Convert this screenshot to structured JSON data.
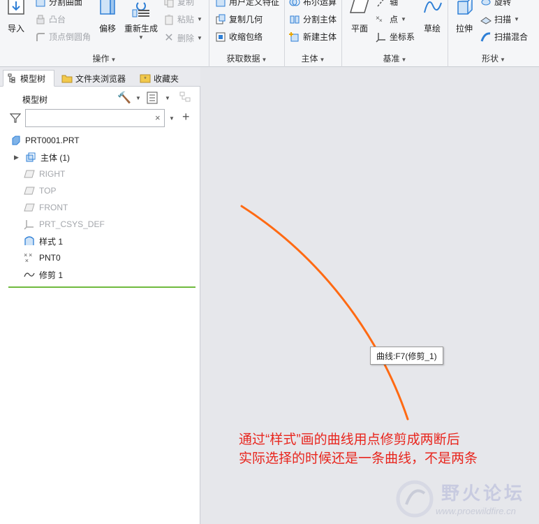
{
  "ribbon": {
    "import_label": "导入",
    "split_surface_label": "分割曲面",
    "boss_label": "凸台",
    "vertex_round_label": "顶点倒圆角",
    "offset_label": "偏移",
    "regenerate_label": "重新生成",
    "copy_label": "复制",
    "paste_label": "粘贴",
    "delete_label": "删除",
    "ops_group_label": "操作",
    "udf_label": "用户定义特征",
    "copy_geometry_label": "复制几何",
    "shrinkwrap_label": "收缩包络",
    "get_data_group_label": "获取数据",
    "boolean_label": "布尔运算",
    "split_body_label": "分割主体",
    "new_body_label": "新建主体",
    "body_group_label": "主体",
    "plane_label": "平面",
    "axis_label": "轴",
    "point_label": "点",
    "csys_label": "坐标系",
    "sketch_label": "草绘",
    "datum_group_label": "基准",
    "extrude_label": "拉伸",
    "revolve_label": "旋转",
    "sweep_label": "扫描",
    "swept_blend_label": "扫描混合",
    "shape_group_label": "形状"
  },
  "navigator": {
    "tabs": [
      {
        "label": "模型树"
      },
      {
        "label": "文件夹浏览器"
      },
      {
        "label": "收藏夹"
      }
    ],
    "tree_title": "模型树",
    "search": {
      "value": "",
      "placeholder": ""
    },
    "items": [
      {
        "label": "PRT0001.PRT"
      },
      {
        "label": "主体 (1)"
      },
      {
        "label": "RIGHT"
      },
      {
        "label": "TOP"
      },
      {
        "label": "FRONT"
      },
      {
        "label": "PRT_CSYS_DEF"
      },
      {
        "label": "样式 1"
      },
      {
        "label": "PNT0"
      },
      {
        "label": "修剪 1"
      }
    ]
  },
  "canvas": {
    "tooltip": "曲线:F7(修剪_1)",
    "annotation_line1": "通过“样式”画的曲线用点修剪成两断后",
    "annotation_line2": "实际选择的时候还是一条曲线，不是两条",
    "curve_color": "#ff6a13"
  },
  "watermark": {
    "title": "野火论坛",
    "url": "www.proewildfire.cn"
  },
  "colors": {
    "accent_blue": "#2e7fd6",
    "insert_line": "#6fba3d",
    "annotation": "#e8261e"
  }
}
